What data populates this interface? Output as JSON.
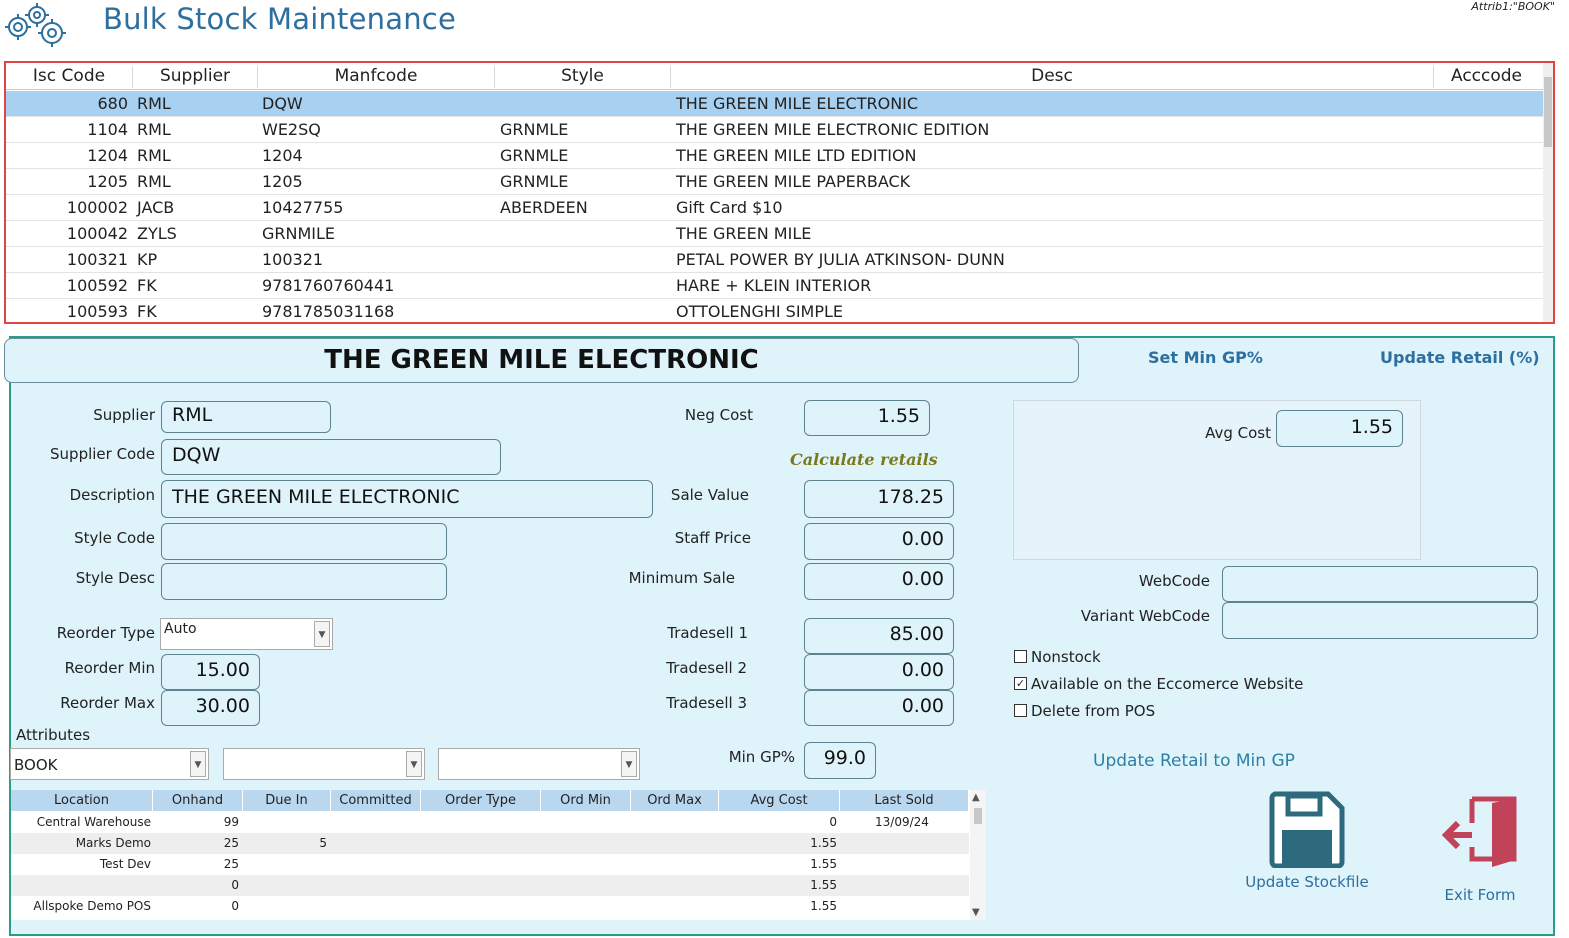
{
  "header": {
    "title": "Bulk Stock Maintenance",
    "attrib": "Attrib1:\"BOOK\""
  },
  "stock_grid": {
    "columns": [
      "Isc Code",
      "Supplier",
      "Manfcode",
      "Style",
      "Desc",
      "Acccode"
    ],
    "rows": [
      {
        "isc": "680",
        "supplier": "RML",
        "manf": "DQW",
        "style": "",
        "desc": "THE GREEN MILE ELECTRONIC",
        "acc": ""
      },
      {
        "isc": "1104",
        "supplier": "RML",
        "manf": "WE2SQ",
        "style": "GRNMLE",
        "desc": "THE GREEN MILE ELECTRONIC EDITION",
        "acc": ""
      },
      {
        "isc": "1204",
        "supplier": "RML",
        "manf": "1204",
        "style": "GRNMLE",
        "desc": "THE GREEN MILE LTD EDITION",
        "acc": ""
      },
      {
        "isc": "1205",
        "supplier": "RML",
        "manf": "1205",
        "style": "GRNMLE",
        "desc": "THE GREEN MILE PAPERBACK",
        "acc": ""
      },
      {
        "isc": "100002",
        "supplier": "JACB",
        "manf": "10427755",
        "style": "ABERDEEN",
        "desc": "Gift Card $10",
        "acc": ""
      },
      {
        "isc": "100042",
        "supplier": "ZYLS",
        "manf": "GRNMILE",
        "style": "",
        "desc": "THE GREEN MILE",
        "acc": ""
      },
      {
        "isc": "100321",
        "supplier": "KP",
        "manf": "100321",
        "style": "",
        "desc": "PETAL POWER BY JULIA ATKINSON- DUNN",
        "acc": ""
      },
      {
        "isc": "100592",
        "supplier": "FK",
        "manf": "9781760760441",
        "style": "",
        "desc": "HARE + KLEIN INTERIOR",
        "acc": ""
      },
      {
        "isc": "100593",
        "supplier": "FK",
        "manf": "9781785031168",
        "style": "",
        "desc": "OTTOLENGHI SIMPLE",
        "acc": ""
      }
    ]
  },
  "detail": {
    "name": "THE GREEN MILE ELECTRONIC",
    "set_min_gp": "Set Min GP%",
    "update_retail_pct": "Update Retail (%)",
    "labels": {
      "supplier": "Supplier",
      "supplier_code": "Supplier Code",
      "description": "Description",
      "style_code": "Style Code",
      "style_desc": "Style Desc",
      "reorder_type": "Reorder Type",
      "reorder_min": "Reorder Min",
      "reorder_max": "Reorder Max",
      "attributes": "Attributes",
      "neg_cost": "Neg Cost",
      "calculate_retails": "Calculate retails",
      "sale_value": "Sale Value",
      "staff_price": "Staff Price",
      "minimum_sale": "Minimum Sale",
      "tradesell1": "Tradesell 1",
      "tradesell2": "Tradesell 2",
      "tradesell3": "Tradesell 3",
      "min_gp": "Min GP%",
      "avg_cost": "Avg Cost",
      "webcode": "WebCode",
      "variant_webcode": "Variant WebCode"
    },
    "values": {
      "supplier": "RML",
      "supplier_code": "DQW",
      "description": "THE GREEN MILE ELECTRONIC",
      "style_code": "",
      "style_desc": "",
      "reorder_type": "Auto",
      "reorder_min": "15.00",
      "reorder_max": "30.00",
      "attr1": "BOOK",
      "attr2": "",
      "attr3": "",
      "neg_cost": "1.55",
      "sale_value": "178.25",
      "staff_price": "0.00",
      "minimum_sale": "0.00",
      "tradesell1": "85.00",
      "tradesell2": "0.00",
      "tradesell3": "0.00",
      "min_gp": "99.0",
      "avg_cost": "1.55",
      "webcode": "",
      "variant_webcode": ""
    },
    "checkboxes": {
      "nonstock": {
        "label": "Nonstock",
        "checked": false
      },
      "ecommerce": {
        "label": "Available on the Eccomerce Website",
        "checked": true
      },
      "delete_pos": {
        "label": "Delete from POS",
        "checked": false
      }
    },
    "update_retail_min_gp": "Update Retail to Min GP",
    "update_stockfile": "Update Stockfile",
    "exit_form": "Exit Form"
  },
  "location_grid": {
    "columns": [
      "Location",
      "Onhand",
      "Due In",
      "Committed",
      "Order Type",
      "Ord Min",
      "Ord Max",
      "Avg Cost",
      "Last Sold"
    ],
    "rows": [
      {
        "location": "Central Warehouse",
        "onhand": "99",
        "due_in": "",
        "committed": "",
        "order_type": "",
        "ord_min": "",
        "ord_max": "",
        "avg_cost": "0",
        "last_sold": "13/09/24"
      },
      {
        "location": "Marks Demo",
        "onhand": "25",
        "due_in": "5",
        "committed": "",
        "order_type": "",
        "ord_min": "",
        "ord_max": "",
        "avg_cost": "1.55",
        "last_sold": ""
      },
      {
        "location": "Test Dev",
        "onhand": "25",
        "due_in": "",
        "committed": "",
        "order_type": "",
        "ord_min": "",
        "ord_max": "",
        "avg_cost": "1.55",
        "last_sold": ""
      },
      {
        "location": "",
        "onhand": "0",
        "due_in": "",
        "committed": "",
        "order_type": "",
        "ord_min": "",
        "ord_max": "",
        "avg_cost": "1.55",
        "last_sold": ""
      },
      {
        "location": "Allspoke Demo POS",
        "onhand": "0",
        "due_in": "",
        "committed": "",
        "order_type": "",
        "ord_min": "",
        "ord_max": "",
        "avg_cost": "1.55",
        "last_sold": ""
      }
    ]
  },
  "colors": {
    "accent": "#2d6f9e",
    "grid_border": "#e04545",
    "panel_border": "#2a9d84",
    "panel_bg": "#dff3fb",
    "selected_row": "#a8d0f0",
    "calc_text": "#7a7a1a",
    "save_icon": "#2e6a7e",
    "exit_icon": "#c0435a"
  },
  "icons": {
    "logo": "gears-icon",
    "save": "floppy-disk-icon",
    "exit": "exit-door-icon"
  }
}
